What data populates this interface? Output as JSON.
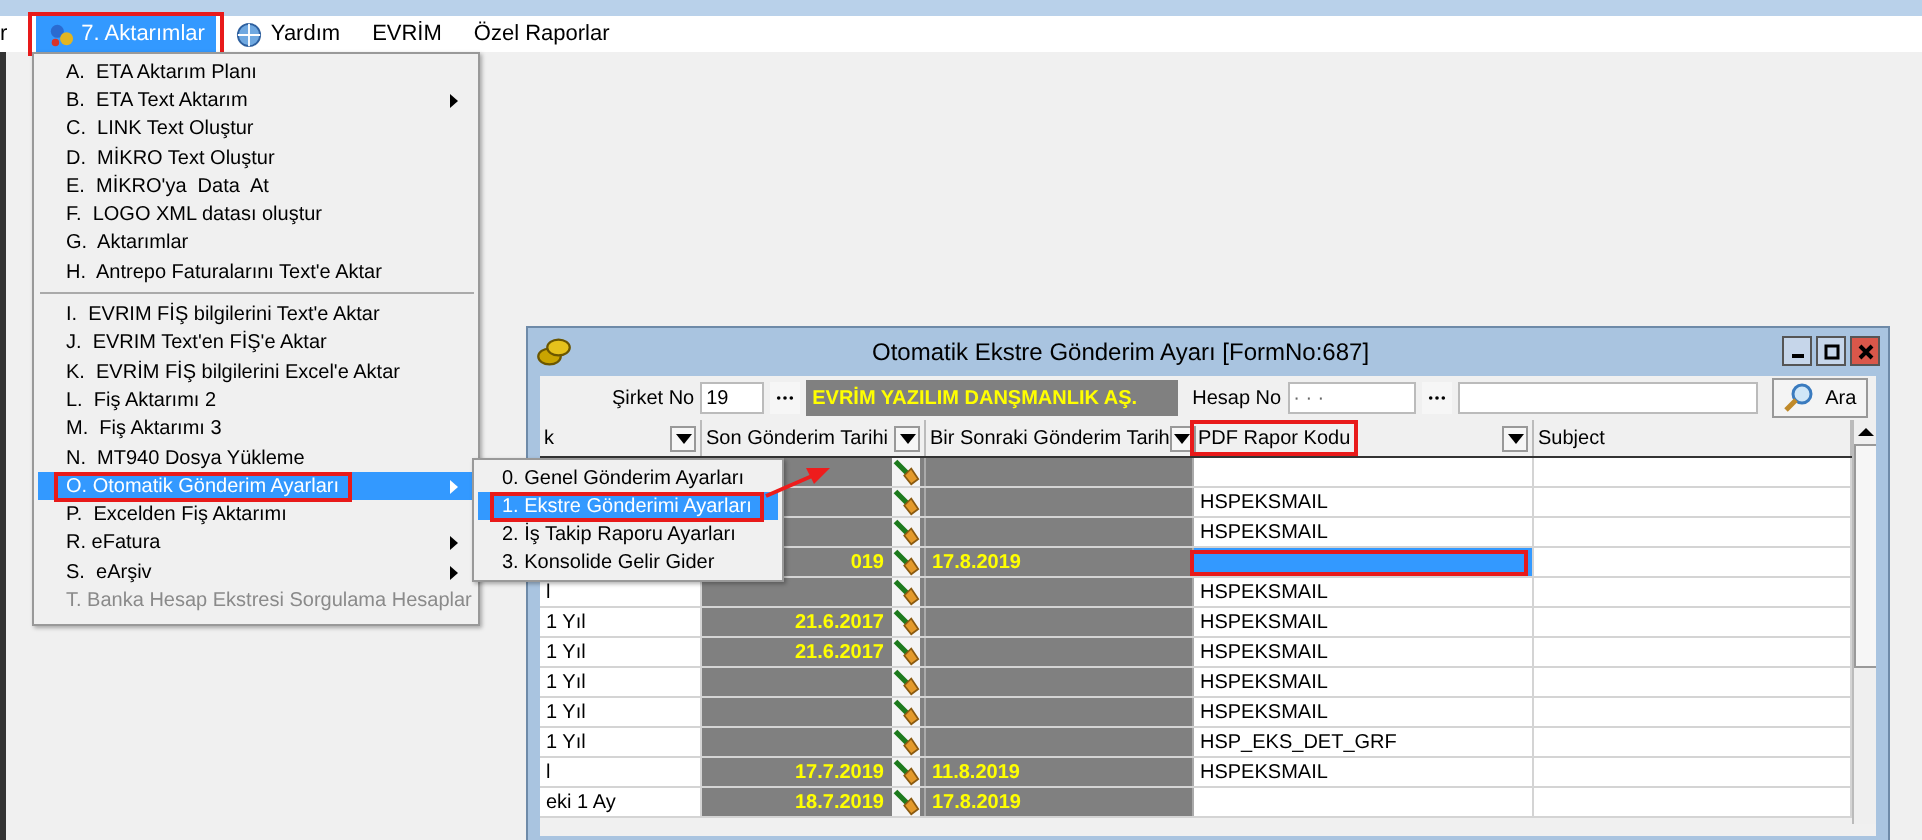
{
  "menu_bar": {
    "items": [
      {
        "label": "r",
        "kind": "plain",
        "selected": false,
        "annotated": false
      },
      {
        "label": "7. Aktarımlar",
        "kind": "app",
        "selected": true,
        "annotated": true
      },
      {
        "label": "Yardım",
        "kind": "help",
        "selected": false,
        "annotated": false
      },
      {
        "label": "EVRİM",
        "kind": "plain",
        "selected": false,
        "annotated": false
      },
      {
        "label": "Özel Raporlar",
        "kind": "plain",
        "selected": false,
        "annotated": false
      }
    ]
  },
  "dropdown_menu": {
    "items": [
      {
        "kind": "item",
        "label": "A.  ETA Aktarım Planı",
        "submenu": false,
        "disabled": false,
        "selected": false,
        "annotated": false
      },
      {
        "kind": "item",
        "label": "B.  ETA Text Aktarım",
        "submenu": true,
        "disabled": false,
        "selected": false,
        "annotated": false
      },
      {
        "kind": "item",
        "label": "C.  LINK Text Oluştur",
        "submenu": false,
        "disabled": false,
        "selected": false,
        "annotated": false
      },
      {
        "kind": "item",
        "label": "D.  MİKRO Text Oluştur",
        "submenu": false,
        "disabled": false,
        "selected": false,
        "annotated": false
      },
      {
        "kind": "item",
        "label": "E.  MİKRO'ya  Data  At",
        "submenu": false,
        "disabled": false,
        "selected": false,
        "annotated": false
      },
      {
        "kind": "item",
        "label": "F.  LOGO XML datası oluştur",
        "submenu": false,
        "disabled": false,
        "selected": false,
        "annotated": false
      },
      {
        "kind": "item",
        "label": "G.  Aktarımlar",
        "submenu": false,
        "disabled": false,
        "selected": false,
        "annotated": false
      },
      {
        "kind": "item",
        "label": "H.  Antrepo Faturalarını Text'e Aktar",
        "submenu": false,
        "disabled": false,
        "selected": false,
        "annotated": false
      },
      {
        "kind": "separator"
      },
      {
        "kind": "item",
        "label": "I.  EVRIM FİŞ bilgilerini Text'e Aktar",
        "submenu": false,
        "disabled": false,
        "selected": false,
        "annotated": false
      },
      {
        "kind": "item",
        "label": "J.  EVRIM Text'en FİŞ'e Aktar",
        "submenu": false,
        "disabled": false,
        "selected": false,
        "annotated": false
      },
      {
        "kind": "item",
        "label": "K.  EVRİM FİŞ bilgilerini Excel'e Aktar",
        "submenu": false,
        "disabled": false,
        "selected": false,
        "annotated": false
      },
      {
        "kind": "item",
        "label": "L.  Fiş Aktarımı 2",
        "submenu": false,
        "disabled": false,
        "selected": false,
        "annotated": false
      },
      {
        "kind": "item",
        "label": "M.  Fiş Aktarımı 3",
        "submenu": false,
        "disabled": false,
        "selected": false,
        "annotated": false
      },
      {
        "kind": "item",
        "label": "N.  MT940 Dosya Yükleme",
        "submenu": false,
        "disabled": false,
        "selected": false,
        "annotated": false
      },
      {
        "kind": "item",
        "label": "O. Otomatik Gönderim Ayarları",
        "submenu": true,
        "disabled": false,
        "selected": true,
        "annotated": true
      },
      {
        "kind": "item",
        "label": "P.  Excelden Fiş Aktarımı",
        "submenu": false,
        "disabled": false,
        "selected": false,
        "annotated": false
      },
      {
        "kind": "item",
        "label": "R. eFatura",
        "submenu": true,
        "disabled": false,
        "selected": false,
        "annotated": false
      },
      {
        "kind": "item",
        "label": "S.  eArşiv",
        "submenu": true,
        "disabled": false,
        "selected": false,
        "annotated": false
      },
      {
        "kind": "item",
        "label": "T. Banka Hesap Ekstresi Sorgulama Hesaplar",
        "submenu": false,
        "disabled": true,
        "selected": false,
        "annotated": false
      }
    ]
  },
  "submenu": {
    "items": [
      {
        "label": "0. Genel Gönderim Ayarları",
        "selected": false,
        "annotated": false
      },
      {
        "label": "1. Ekstre Gönderimi Ayarları",
        "selected": true,
        "annotated": true
      },
      {
        "label": "2. İş Takip Raporu Ayarları",
        "selected": false,
        "annotated": false
      },
      {
        "label": "3. Konsolide Gelir Gider",
        "selected": false,
        "annotated": false
      }
    ]
  },
  "form_window": {
    "title": "Otomatik Ekstre Gönderim Ayarı [FormNo:687]",
    "filters": {
      "company_label": "Şirket No",
      "company_no": "19",
      "company_name": "EVRİM YAZILIM DANŞMANLIK AŞ.",
      "account_label": "Hesap No",
      "account_no": "· · ·",
      "search_button": "Ara"
    },
    "table": {
      "columns": [
        {
          "label": "k",
          "annotated": false
        },
        {
          "label": "Son Gönderim Tarihi",
          "annotated": false
        },
        {
          "label": "Bir Sonraki Gönderim Tarih",
          "annotated": false
        },
        {
          "label": "PDF Rapor Kodu",
          "annotated": true
        },
        {
          "label": "Subject",
          "annotated": false
        }
      ],
      "rows": [
        {
          "cells": [
            "",
            "",
            "",
            "",
            ""
          ],
          "selected": false
        },
        {
          "cells": [
            "",
            "",
            "",
            "HSPEKSMAIL",
            ""
          ],
          "selected": false
        },
        {
          "cells": [
            "",
            "",
            "",
            "HSPEKSMAIL",
            ""
          ],
          "selected": false
        },
        {
          "cells": [
            "",
            "019",
            "17.8.2019",
            "",
            ""
          ],
          "selected": true
        },
        {
          "cells": [
            "l",
            "",
            "",
            "HSPEKSMAIL",
            ""
          ],
          "selected": false
        },
        {
          "cells": [
            "1 Yıl",
            "21.6.2017",
            "",
            "HSPEKSMAIL",
            ""
          ],
          "selected": false
        },
        {
          "cells": [
            "1 Yıl",
            "21.6.2017",
            "",
            "HSPEKSMAIL",
            ""
          ],
          "selected": false
        },
        {
          "cells": [
            "1 Yıl",
            "",
            "",
            "HSPEKSMAIL",
            ""
          ],
          "selected": false
        },
        {
          "cells": [
            "1 Yıl",
            "",
            "",
            "HSPEKSMAIL",
            ""
          ],
          "selected": false
        },
        {
          "cells": [
            "1 Yıl",
            "",
            "",
            "HSP_EKS_DET_GRF",
            ""
          ],
          "selected": false
        },
        {
          "cells": [
            "l",
            "17.7.2019",
            "11.8.2019",
            "HSPEKSMAIL",
            ""
          ],
          "selected": false
        },
        {
          "cells": [
            "eki 1 Ay",
            "18.7.2019",
            "17.8.2019",
            "",
            ""
          ],
          "selected": false
        }
      ]
    }
  }
}
